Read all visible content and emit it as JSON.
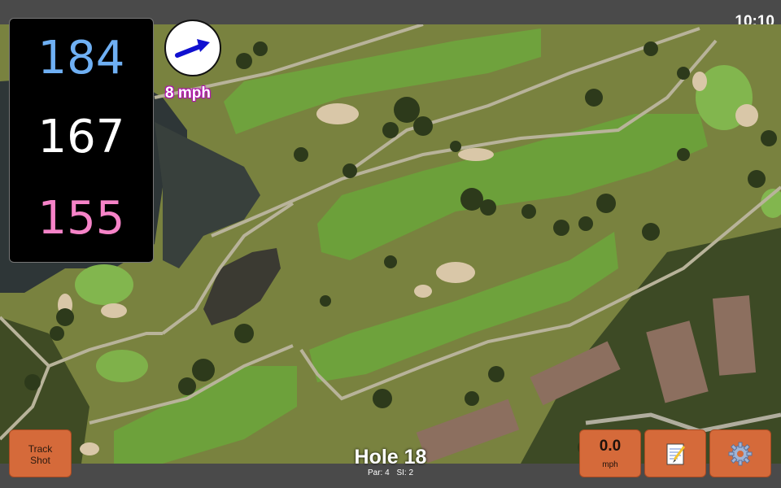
{
  "status_bar": {
    "time": "10:10"
  },
  "yardages": {
    "back": "184",
    "middle": "167",
    "front": "155"
  },
  "wind": {
    "speed_label": "8 mph",
    "direction_icon": "arrow-right-icon"
  },
  "hole": {
    "title": "Hole 18",
    "par_label": "Par: 4",
    "si_label": "SI: 2"
  },
  "buttons": {
    "track_shot_line1": "Track",
    "track_shot_line2": "Shot",
    "speed_value": "0.0",
    "speed_unit": "mph",
    "notes_icon": "notepad-icon",
    "settings_icon": "gear-icon"
  },
  "colors": {
    "back_yardage": "#6fb0f4",
    "middle_yardage": "#ffffff",
    "front_yardage": "#f683c8",
    "button_fill": "#d56a3a",
    "chrome": "#4a4a4a"
  }
}
